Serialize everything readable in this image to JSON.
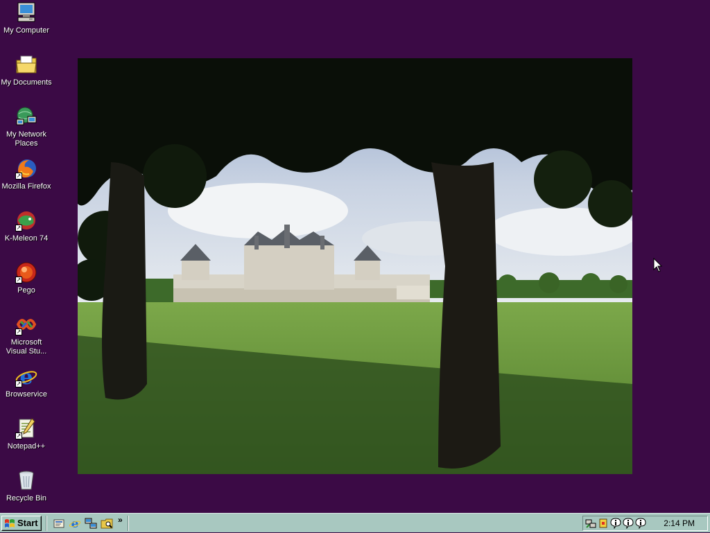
{
  "desktop": {
    "background_color": "#3b0a45",
    "icons": [
      {
        "label": "My Computer",
        "icon": "my-computer-icon"
      },
      {
        "label": "My Documents",
        "icon": "my-documents-icon"
      },
      {
        "label": "My Network Places",
        "icon": "network-places-icon"
      },
      {
        "label": "Mozilla Firefox",
        "icon": "firefox-icon"
      },
      {
        "label": "K-Meleon 74",
        "icon": "k-meleon-icon"
      },
      {
        "label": "Pego",
        "icon": "pego-icon"
      },
      {
        "label": "Microsoft Visual Stu...",
        "icon": "visual-studio-icon"
      },
      {
        "label": "Browservice",
        "icon": "browservice-icon"
      },
      {
        "label": "Notepad++",
        "icon": "notepad-plus-plus-icon"
      },
      {
        "label": "Recycle Bin",
        "icon": "recycle-bin-icon"
      }
    ]
  },
  "wallpaper": {
    "subject": "chateau-behind-trees"
  },
  "taskbar": {
    "color": "#a8c8c0",
    "start_label": "Start",
    "quick_launch": [
      {
        "icon": "show-desktop-icon"
      },
      {
        "icon": "internet-explorer-icon"
      },
      {
        "icon": "network-icon"
      },
      {
        "icon": "folder-search-icon"
      }
    ],
    "quick_launch_more": "»",
    "tray_icons": [
      {
        "icon": "network-tray-icon"
      },
      {
        "icon": "security-tray-icon"
      },
      {
        "icon": "info-tray-icon"
      },
      {
        "icon": "info-tray-icon"
      },
      {
        "icon": "info-tray-icon"
      }
    ],
    "clock": "2:14 PM"
  }
}
